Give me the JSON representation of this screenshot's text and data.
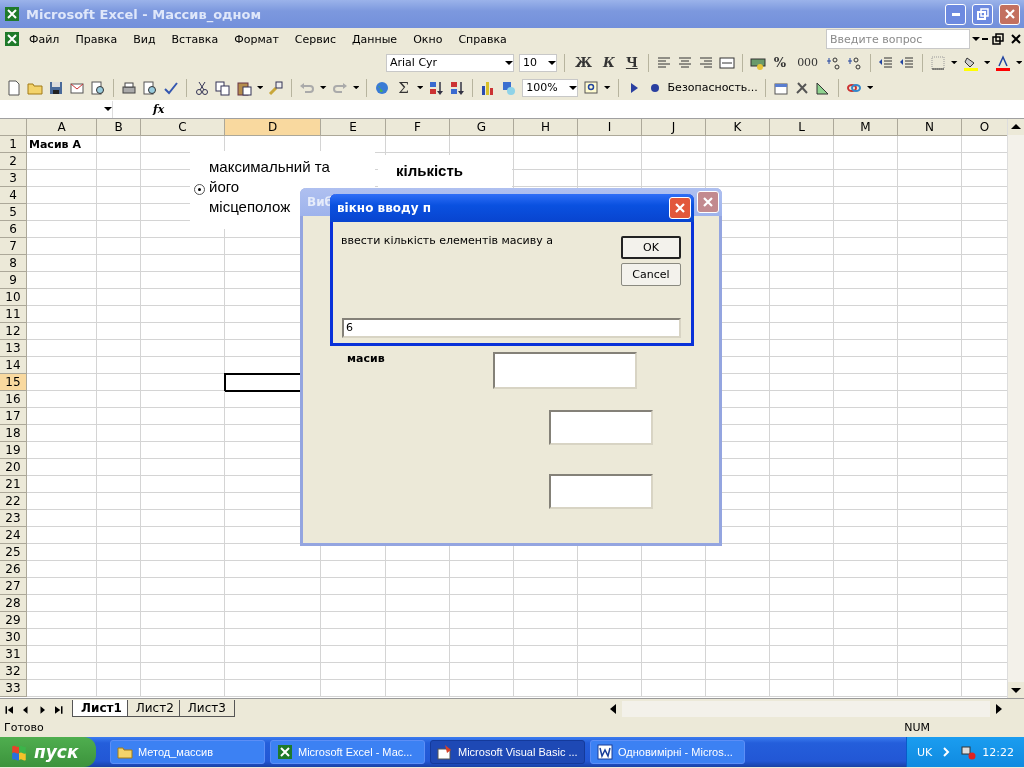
{
  "window": {
    "title": "Microsoft Excel - Массив_одном"
  },
  "menu": [
    {
      "label": "Файл"
    },
    {
      "label": "Правка"
    },
    {
      "label": "Вид"
    },
    {
      "label": "Вставка"
    },
    {
      "label": "Формат"
    },
    {
      "label": "Сервис"
    },
    {
      "label": "Данные"
    },
    {
      "label": "Окно"
    },
    {
      "label": "Справка"
    }
  ],
  "help_field": {
    "placeholder": "Введите вопрос"
  },
  "formatting_toolbar": {
    "font": "Arial Cyr",
    "size": "10",
    "bold": "Ж",
    "italic": "К",
    "underline": "Ч",
    "percent": "%",
    "thousands": "000"
  },
  "standard_toolbar": {
    "sum": "Σ",
    "zoom": "100%"
  },
  "security_toolbar": {
    "label": "Безопасность..."
  },
  "formula_bar": {
    "fx": "fx"
  },
  "sheet": {
    "columns": [
      {
        "label": "A",
        "selected": false
      },
      {
        "label": "B",
        "selected": false
      },
      {
        "label": "C",
        "selected": false
      },
      {
        "label": "D",
        "selected": true
      },
      {
        "label": "E",
        "selected": false
      },
      {
        "label": "F",
        "selected": false
      },
      {
        "label": "G",
        "selected": false
      },
      {
        "label": "H",
        "selected": false
      },
      {
        "label": "I",
        "selected": false
      },
      {
        "label": "J",
        "selected": false
      },
      {
        "label": "K",
        "selected": false
      },
      {
        "label": "L",
        "selected": false
      },
      {
        "label": "M",
        "selected": false
      },
      {
        "label": "N",
        "selected": false
      },
      {
        "label": "O",
        "selected": false
      }
    ],
    "rows": [
      {
        "label": "1",
        "selected": false,
        "cells": [
          {
            "text": "Масив А"
          }
        ]
      },
      {
        "label": "2",
        "selected": false
      },
      {
        "label": "3",
        "selected": false
      },
      {
        "label": "4",
        "selected": false
      },
      {
        "label": "5",
        "selected": false
      },
      {
        "label": "6",
        "selected": false
      },
      {
        "label": "7",
        "selected": false
      },
      {
        "label": "8",
        "selected": false
      },
      {
        "label": "9",
        "selected": false
      },
      {
        "label": "10",
        "selected": false
      },
      {
        "label": "11",
        "selected": false
      },
      {
        "label": "12",
        "selected": false
      },
      {
        "label": "13",
        "selected": false
      },
      {
        "label": "14",
        "selected": false
      },
      {
        "label": "15",
        "selected": true
      },
      {
        "label": "16",
        "selected": false
      },
      {
        "label": "17",
        "selected": false
      },
      {
        "label": "18",
        "selected": false
      },
      {
        "label": "19",
        "selected": false
      },
      {
        "label": "20",
        "selected": false
      },
      {
        "label": "21",
        "selected": false
      },
      {
        "label": "22",
        "selected": false
      },
      {
        "label": "23",
        "selected": false
      },
      {
        "label": "24",
        "selected": false
      },
      {
        "label": "25",
        "selected": false
      },
      {
        "label": "26",
        "selected": false
      },
      {
        "label": "27",
        "selected": false
      },
      {
        "label": "28",
        "selected": false
      },
      {
        "label": "29",
        "selected": false
      },
      {
        "label": "30",
        "selected": false
      },
      {
        "label": "31",
        "selected": false
      },
      {
        "label": "32",
        "selected": false
      },
      {
        "label": "33",
        "selected": false
      }
    ]
  },
  "option_controls": [
    {
      "lines": [
        "максимальний та",
        "його",
        "місцеполож"
      ],
      "selected": true
    },
    {
      "lines": [
        "кількість"
      ]
    }
  ],
  "back_dialog": {
    "title": "Виб",
    "label": "масив"
  },
  "input_dialog": {
    "title": "вікно вводу п",
    "prompt": "ввести кількість елементів масиву а",
    "buttons": [
      {
        "label": "OK",
        "default": true
      },
      {
        "label": "Cancel",
        "default": false
      }
    ],
    "value": "6"
  },
  "sheet_tabs": [
    {
      "label": "Лист1",
      "selected": true
    },
    {
      "label": "Лист2",
      "selected": false
    },
    {
      "label": "Лист3",
      "selected": false
    }
  ],
  "status_bar": {
    "text": "Готово",
    "num": "NUM"
  },
  "taskbar": {
    "start": "пуск",
    "tasks": [
      {
        "label": "Метод_массив",
        "selected": false,
        "kind": "folder"
      },
      {
        "label": "Microsoft Excel - Мас...",
        "selected": false,
        "kind": "excel"
      },
      {
        "label": "Microsoft Visual Basic ...",
        "selected": true,
        "kind": "vba"
      },
      {
        "label": "Одновимірні - Micros...",
        "selected": false,
        "kind": "word"
      }
    ],
    "language": "UK",
    "clock": "12:22"
  }
}
